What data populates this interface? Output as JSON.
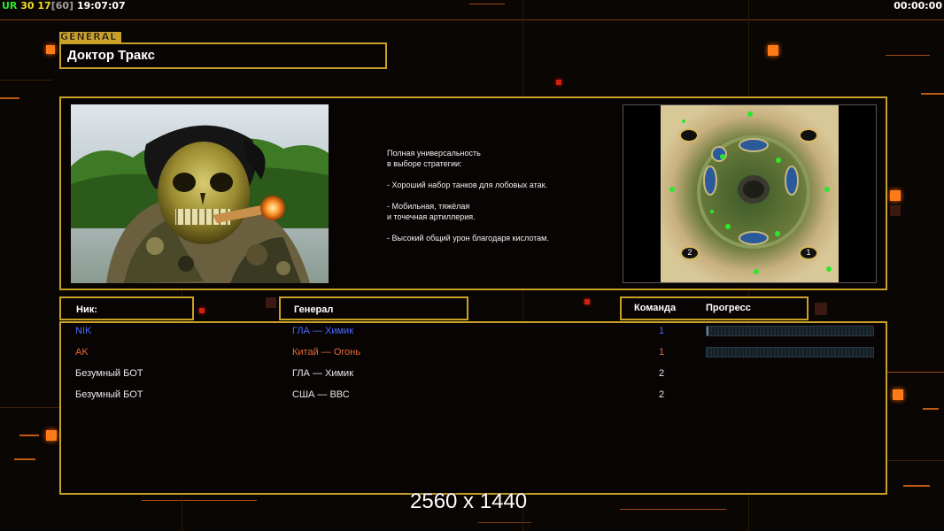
{
  "hud": {
    "ur_label": "UR",
    "fps": "30",
    "logic_fps": "17",
    "logic_fps_max": "[60]",
    "clock": "19:07:07",
    "timer": "00:00:00"
  },
  "general": {
    "tag": "GENERAL",
    "name": "Доктор Тракс",
    "portrait_icon": "skull-soldier-portrait",
    "map_icon": "skirmish-map-preview",
    "description": "Полная универсальность\nв выборе стратегии:\n\n- Хороший набор танков для лобовых атак.\n\n- Мобильная, тяжёлая\nи точечная артиллерия.\n\n- Высокий общий урон благодаря кислотам."
  },
  "map_markers": [
    "2",
    "1"
  ],
  "headers": {
    "nick": "Ник:",
    "general": "Генерал",
    "team": "Команда",
    "progress": "Прогресс"
  },
  "players": [
    {
      "nick": "NIK",
      "general": "ГЛА — Химик",
      "team": "1",
      "color": "#4a6cff",
      "progress": 0.01
    },
    {
      "nick": "AK",
      "general": "Китай — Огонь",
      "team": "1",
      "color": "#e06a3a",
      "progress": 0
    },
    {
      "nick": "Безумный БОТ",
      "general": "ГЛА — Химик",
      "team": "2",
      "color": "#e8e8e8"
    },
    {
      "nick": "Безумный БОТ",
      "general": "США — ВВС",
      "team": "2",
      "color": "#e8e8e8"
    }
  ],
  "resolution": "2560 x 1440",
  "colors": {
    "accent": "#c8a028",
    "hud_green": "#2ce82c",
    "hud_yellow": "#f0e020",
    "hud_white": "#ffffff"
  }
}
